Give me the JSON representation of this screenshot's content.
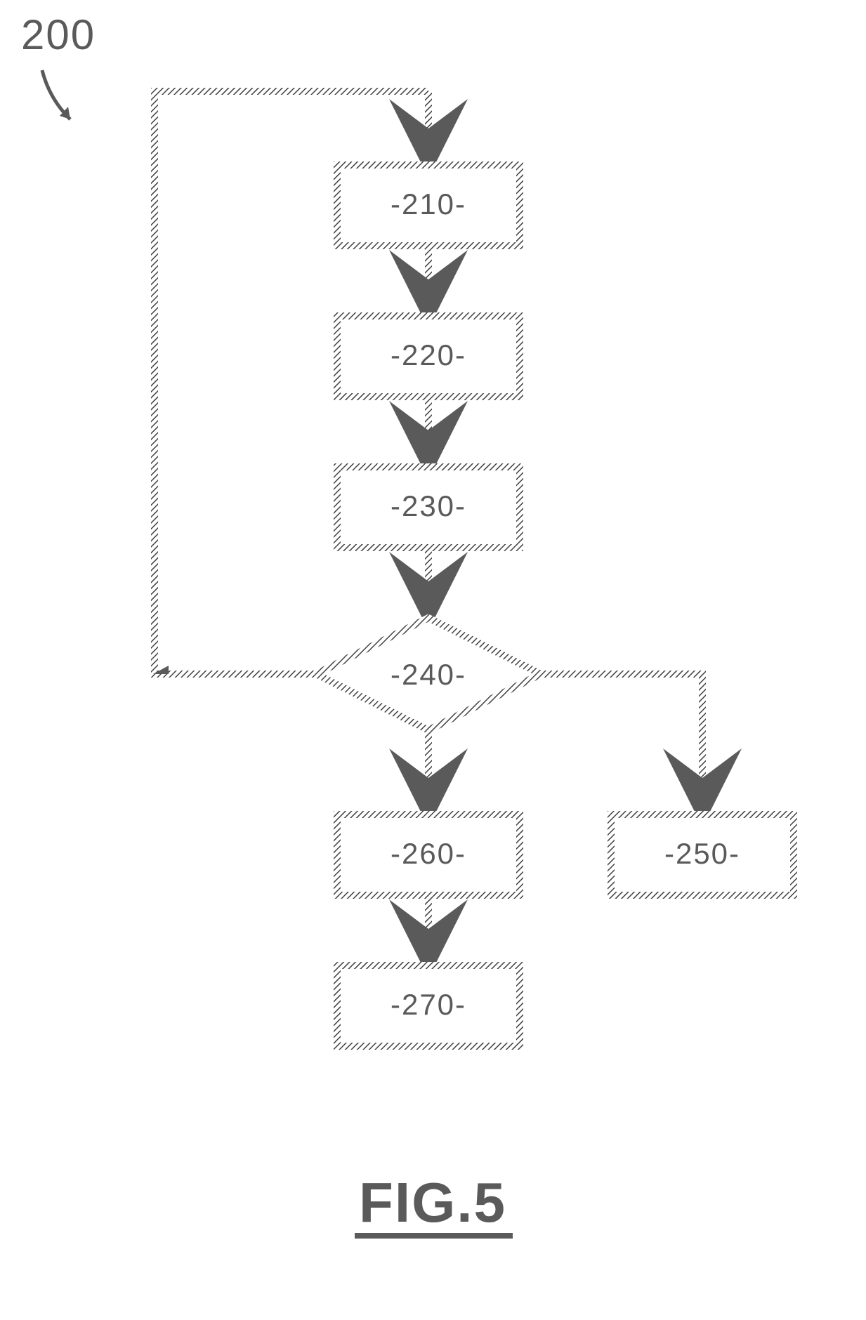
{
  "figure": {
    "reference_number": "200",
    "caption": "FIG.5",
    "nodes": {
      "n210": "-210-",
      "n220": "-220-",
      "n230": "-230-",
      "n240": "-240-",
      "n250": "-250-",
      "n260": "-260-",
      "n270": "-270-"
    },
    "edges": [
      {
        "from": "loop-top",
        "to": "n210"
      },
      {
        "from": "n210",
        "to": "n220"
      },
      {
        "from": "n220",
        "to": "n230"
      },
      {
        "from": "n230",
        "to": "n240"
      },
      {
        "from": "n240",
        "to": "n260"
      },
      {
        "from": "n240",
        "to": "n250"
      },
      {
        "from": "n260",
        "to": "n270"
      },
      {
        "from": "n240",
        "to": "loop-top",
        "note": "feedback"
      }
    ]
  }
}
